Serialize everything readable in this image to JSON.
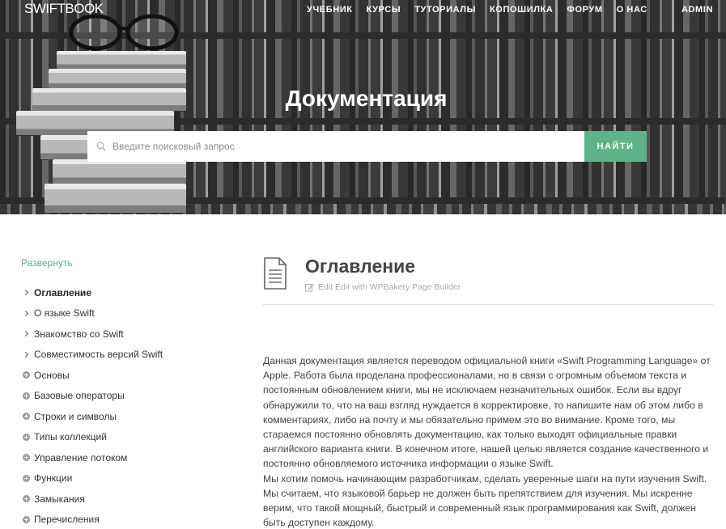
{
  "header": {
    "logo": "SWIFTBOOK",
    "nav": [
      "УЧЕБНИК",
      "КУРСЫ",
      "ТУТОРИАЛЫ",
      "КОПОШИЛКА",
      "ФОРУМ",
      "О НАС"
    ],
    "admin": "ADMIN"
  },
  "hero": {
    "title": "Документация",
    "search_placeholder": "Введите поисковый запрос",
    "search_button": "НАЙТИ"
  },
  "sidebar": {
    "expand": "Развернуть",
    "items": [
      {
        "label": "Оглавление",
        "icon": "chevron-right-icon",
        "active": true
      },
      {
        "label": "О языке Swift",
        "icon": "chevron-right-icon"
      },
      {
        "label": "Знакомство со Swift",
        "icon": "chevron-right-icon"
      },
      {
        "label": "Совместимость версий Swift",
        "icon": "chevron-right-icon"
      },
      {
        "label": "Основы",
        "icon": "plus-circle-icon"
      },
      {
        "label": "Базовые операторы",
        "icon": "plus-circle-icon"
      },
      {
        "label": "Строки и символы",
        "icon": "plus-circle-icon"
      },
      {
        "label": "Типы коллекций",
        "icon": "plus-circle-icon"
      },
      {
        "label": "Управление потоком",
        "icon": "plus-circle-icon"
      },
      {
        "label": "Функции",
        "icon": "plus-circle-icon"
      },
      {
        "label": "Замыкания",
        "icon": "plus-circle-icon"
      },
      {
        "label": "Перечисления",
        "icon": "plus-circle-icon"
      }
    ]
  },
  "main": {
    "title": "Оглавление",
    "edit_link": "Edit Edit with WPBakery Page Builder",
    "paragraphs": [
      "Данная документация является переводом официальной книги «Swift Programming Language» от Apple. Работа была проделана профессионалами, но в связи с огромным объемом текста и постоянным обновлением книги, мы не исключаем незначительных ошибок. Если вы вдруг обнаружили то, что на ваш взгляд нуждается в корректировке, то напишите нам об этом либо в комментариях, либо на почту и мы обязательно примем это во внимание. Кроме того, мы стараемся постоянно обновлять документацию, как только выходят официальные правки английского варианта книги. В конечном итоге, нашей целью является создание качественного и постоянно обновляемого источника информации о языке Swift.",
      "Мы хотим помочь начинающим разработчикам, сделать уверенные шаги на пути изучения Swift. Мы считаем, что языковой барьер не должен быть препятствием для изучения. Мы искренне верим, что такой мощный, быстрый и современный язык программирования как Swift, должен быть доступен каждому."
    ]
  },
  "colors": {
    "accent": "#5fb388",
    "text": "#444444"
  }
}
